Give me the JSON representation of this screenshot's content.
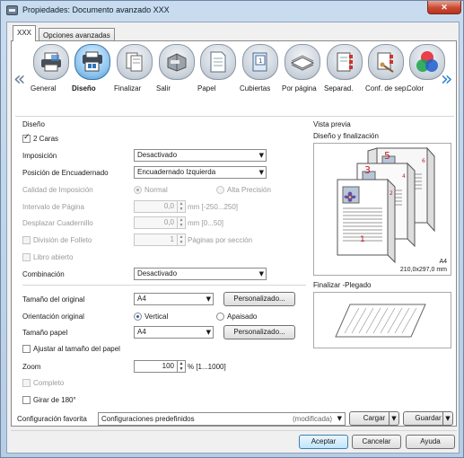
{
  "window": {
    "title": "Propiedades: Documento avanzado XXX",
    "close_symbol": "✕"
  },
  "tabs": [
    {
      "label": "XXX",
      "active": true
    },
    {
      "label": "Opciones avanzadas",
      "active": false
    }
  ],
  "toolbar": {
    "items": [
      {
        "label": "General",
        "icon": "printer-icon",
        "selected": false
      },
      {
        "label": "Diseño",
        "icon": "layout-icon",
        "selected": true
      },
      {
        "label": "Finalizar",
        "icon": "finishing-icon",
        "selected": false
      },
      {
        "label": "Salir",
        "icon": "output-tray-icon",
        "selected": false
      },
      {
        "label": "Papel",
        "icon": "paper-icon",
        "selected": false
      },
      {
        "label": "Cubiertas",
        "icon": "cover-icon",
        "selected": false
      },
      {
        "label": "Por página",
        "icon": "paper-stack-icon",
        "selected": false
      },
      {
        "label": "Separad.",
        "icon": "separator-icon",
        "selected": false
      },
      {
        "label": "Conf. de sep.",
        "icon": "separator-settings-icon",
        "selected": false
      },
      {
        "label": "Color",
        "icon": "color-icon",
        "selected": false
      }
    ],
    "prev_arrow": "«",
    "next_arrow": "»"
  },
  "layout_section": {
    "title": "Diseño",
    "dos_caras": {
      "label": "2 Caras",
      "checked": true
    },
    "imposicion": {
      "label": "Imposición",
      "value": "Desactivado"
    },
    "posicion_encuadernado": {
      "label": "Posición de Encuadernado",
      "value": "Encuadernado Izquierda"
    },
    "calidad_imposicion": {
      "label": "Calidad de Imposición",
      "option_normal": "Normal",
      "option_alta": "Alta Precisión",
      "selected": "Normal"
    },
    "intervalo_pagina": {
      "label": "Intervalo de Página",
      "value": "0,0",
      "units": "mm [-250...250]"
    },
    "desplazar_cuadernillo": {
      "label": "Desplazar Cuadernillo",
      "value": "0,0",
      "units": "mm [0...50]"
    },
    "division_folleto": {
      "label": "División de Folleto",
      "value": "1",
      "units": "Páginas por sección",
      "checked": false
    },
    "libro_abierto": {
      "label": "Libro abierto",
      "checked": false
    },
    "combinacion": {
      "label": "Combinación",
      "value": "Desactivado"
    }
  },
  "paper_section": {
    "tamano_original": {
      "label": "Tamaño del original",
      "value": "A4",
      "button": "Personalizado..."
    },
    "orientacion": {
      "label": "Orientación original",
      "option_vertical": "Vertical",
      "option_apaisado": "Apaisado",
      "selected": "Vertical"
    },
    "tamano_papel": {
      "label": "Tamaño papel",
      "value": "A4",
      "button": "Personalizado..."
    },
    "ajustar": {
      "label": "Ajustar al tamaño del papel",
      "checked": false
    },
    "zoom": {
      "label": "Zoom",
      "value": "100",
      "units": "% [1...1000]"
    },
    "completo": {
      "label": "Completo",
      "checked": false
    },
    "girar": {
      "label": "Girar de 180°",
      "checked": false
    }
  },
  "preview": {
    "title": "Vista previa",
    "layout_title": "Diseño y finalización",
    "paper_label": "A4",
    "paper_size": "210,0x297,0 mm",
    "page_numbers": [
      "1",
      "2",
      "3",
      "4",
      "5",
      "6"
    ],
    "fold_title": "Finalizar -Plegado"
  },
  "favorites": {
    "label": "Configuración favorita",
    "value": "Configuraciones predefinidos",
    "modified": "(modificada)",
    "load_button": "Cargar",
    "save_button": "Guardar"
  },
  "footer": {
    "ok_button": "Aceptar",
    "cancel_button": "Cancelar",
    "help_button": "Ayuda"
  },
  "colors": {
    "accent": "#3c7fb1",
    "page_number_red": "#c0202a"
  }
}
